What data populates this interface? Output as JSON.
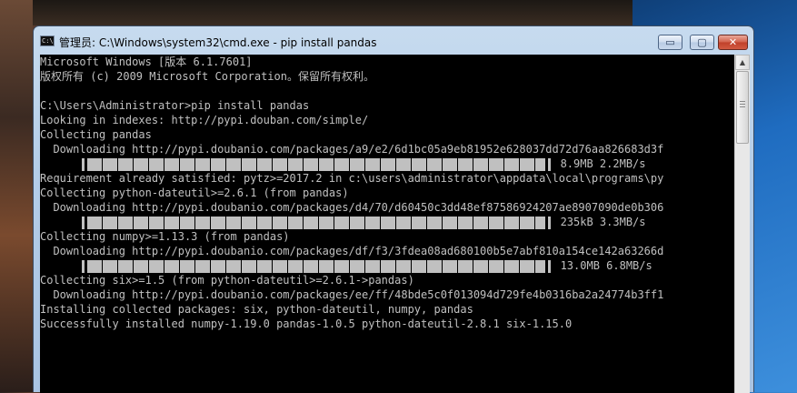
{
  "window": {
    "title": "管理员: C:\\Windows\\system32\\cmd.exe - pip  install pandas",
    "icon_name": "cmd-app-icon",
    "controls": {
      "minimize": "▭",
      "maximize": "▢",
      "close": "✕"
    }
  },
  "console": {
    "lines": [
      {
        "type": "text",
        "text": "Microsoft Windows [版本 6.1.7601]"
      },
      {
        "type": "text",
        "text": "版权所有 (c) 2009 Microsoft Corporation。保留所有权利。"
      },
      {
        "type": "text",
        "text": ""
      },
      {
        "type": "text",
        "text": "C:\\Users\\Administrator>pip install pandas"
      },
      {
        "type": "text",
        "text": "Looking in indexes: http://pypi.douban.com/simple/"
      },
      {
        "type": "text",
        "text": "Collecting pandas"
      },
      {
        "type": "text",
        "text": "  Downloading http://pypi.doubanio.com/packages/a9/e2/6d1bc05a9eb81952e628037dd72d76aa826683d3f"
      },
      {
        "type": "progress",
        "suffix": " 8.9MB 2.2MB/s",
        "progress": 1.0
      },
      {
        "type": "text",
        "text": "Requirement already satisfied: pytz>=2017.2 in c:\\users\\administrator\\appdata\\local\\programs\\py"
      },
      {
        "type": "text",
        "text": "Collecting python-dateutil>=2.6.1 (from pandas)"
      },
      {
        "type": "text",
        "text": "  Downloading http://pypi.doubanio.com/packages/d4/70/d60450c3dd48ef87586924207ae8907090de0b306"
      },
      {
        "type": "progress",
        "suffix": " 235kB 3.3MB/s",
        "progress": 1.0
      },
      {
        "type": "text",
        "text": "Collecting numpy>=1.13.3 (from pandas)"
      },
      {
        "type": "text",
        "text": "  Downloading http://pypi.doubanio.com/packages/df/f3/3fdea08ad680100b5e7abf810a154ce142a63266d"
      },
      {
        "type": "progress",
        "suffix": " 13.0MB 6.8MB/s",
        "progress": 1.0
      },
      {
        "type": "text",
        "text": "Collecting six>=1.5 (from python-dateutil>=2.6.1->pandas)"
      },
      {
        "type": "text",
        "text": "  Downloading http://pypi.doubanio.com/packages/ee/ff/48bde5c0f013094d729fe4b0316ba2a24774b3ff1"
      },
      {
        "type": "text",
        "text": "Installing collected packages: six, python-dateutil, numpy, pandas"
      },
      {
        "type": "text",
        "text": "Successfully installed numpy-1.19.0 pandas-1.0.5 python-dateutil-2.8.1 six-1.15.0"
      }
    ]
  },
  "scrollbar": {
    "up_arrow": "▲"
  },
  "colors": {
    "console_bg": "#000000",
    "console_fg": "#c0c0c0"
  }
}
